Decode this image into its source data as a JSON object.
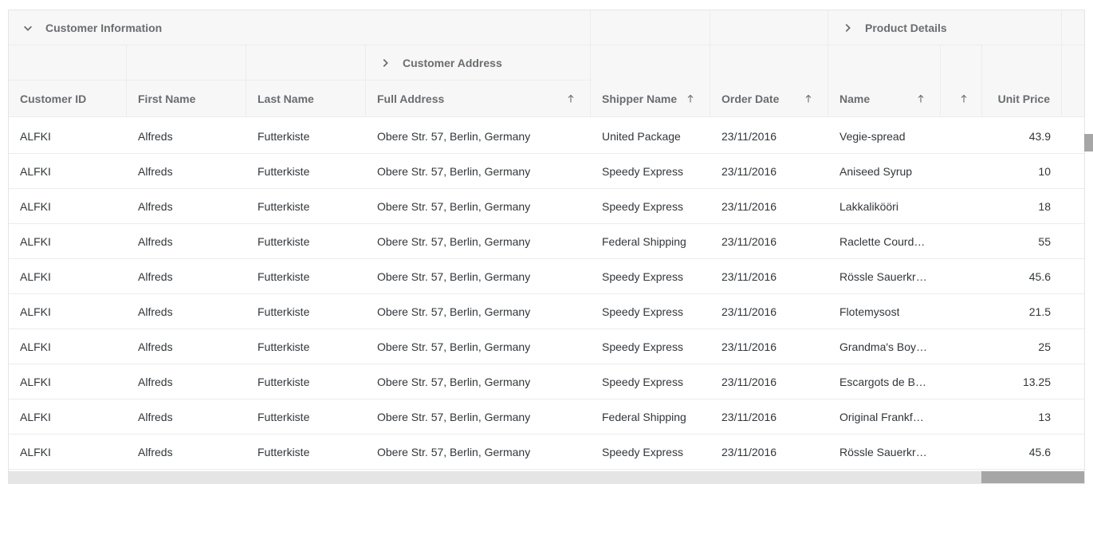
{
  "groups": {
    "customer_info": "Customer Information",
    "customer_address": "Customer Address",
    "product_details": "Product Details"
  },
  "columns": {
    "customer_id": "Customer ID",
    "first_name": "First Name",
    "last_name": "Last Name",
    "full_address": "Full Address",
    "shipper_name": "Shipper Name",
    "order_date": "Order Date",
    "name": "Name",
    "unit_price": "Unit Price"
  },
  "rows": [
    {
      "customer_id": "ALFKI",
      "first_name": "Alfreds",
      "last_name": "Futterkiste",
      "full_address": "Obere Str. 57, Berlin, Germany",
      "shipper": "United Package",
      "order_date": "23/11/2016",
      "product": "Vegie-spread",
      "unit_price": "43.9"
    },
    {
      "customer_id": "ALFKI",
      "first_name": "Alfreds",
      "last_name": "Futterkiste",
      "full_address": "Obere Str. 57, Berlin, Germany",
      "shipper": "Speedy Express",
      "order_date": "23/11/2016",
      "product": "Aniseed Syrup",
      "unit_price": "10"
    },
    {
      "customer_id": "ALFKI",
      "first_name": "Alfreds",
      "last_name": "Futterkiste",
      "full_address": "Obere Str. 57, Berlin, Germany",
      "shipper": "Speedy Express",
      "order_date": "23/11/2016",
      "product": "Lakkalikööri",
      "unit_price": "18"
    },
    {
      "customer_id": "ALFKI",
      "first_name": "Alfreds",
      "last_name": "Futterkiste",
      "full_address": "Obere Str. 57, Berlin, Germany",
      "shipper": "Federal Shipping",
      "order_date": "23/11/2016",
      "product": "Raclette Courdav...",
      "unit_price": "55"
    },
    {
      "customer_id": "ALFKI",
      "first_name": "Alfreds",
      "last_name": "Futterkiste",
      "full_address": "Obere Str. 57, Berlin, Germany",
      "shipper": "Speedy Express",
      "order_date": "23/11/2016",
      "product": "Rössle Sauerkraut",
      "unit_price": "45.6"
    },
    {
      "customer_id": "ALFKI",
      "first_name": "Alfreds",
      "last_name": "Futterkiste",
      "full_address": "Obere Str. 57, Berlin, Germany",
      "shipper": "Speedy Express",
      "order_date": "23/11/2016",
      "product": "Flotemysost",
      "unit_price": "21.5"
    },
    {
      "customer_id": "ALFKI",
      "first_name": "Alfreds",
      "last_name": "Futterkiste",
      "full_address": "Obere Str. 57, Berlin, Germany",
      "shipper": "Speedy Express",
      "order_date": "23/11/2016",
      "product": "Grandma's Boys...",
      "unit_price": "25"
    },
    {
      "customer_id": "ALFKI",
      "first_name": "Alfreds",
      "last_name": "Futterkiste",
      "full_address": "Obere Str. 57, Berlin, Germany",
      "shipper": "Speedy Express",
      "order_date": "23/11/2016",
      "product": "Escargots de Bo...",
      "unit_price": "13.25"
    },
    {
      "customer_id": "ALFKI",
      "first_name": "Alfreds",
      "last_name": "Futterkiste",
      "full_address": "Obere Str. 57, Berlin, Germany",
      "shipper": "Federal Shipping",
      "order_date": "23/11/2016",
      "product": "Original Frankfur...",
      "unit_price": "13"
    },
    {
      "customer_id": "ALFKI",
      "first_name": "Alfreds",
      "last_name": "Futterkiste",
      "full_address": "Obere Str. 57, Berlin, Germany",
      "shipper": "Speedy Express",
      "order_date": "23/11/2016",
      "product": "Rössle Sauerkraut",
      "unit_price": "45.6"
    }
  ]
}
